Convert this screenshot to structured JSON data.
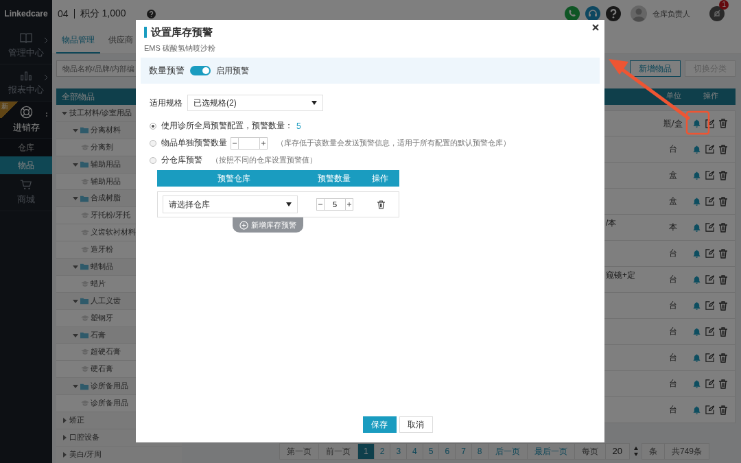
{
  "topbar": {
    "logo": "Linkedcare",
    "store": "04",
    "points": "积分 1,000",
    "user": "仓库负责人",
    "notification_count": "1"
  },
  "sidebar": {
    "items": [
      {
        "label": "管理中心",
        "kind": "module",
        "expanded": false
      },
      {
        "label": "报表中心",
        "kind": "module",
        "expanded": false
      },
      {
        "label": "进销存",
        "kind": "module",
        "expanded": true,
        "badge": "新"
      },
      {
        "label": "仓库",
        "kind": "sub",
        "selected": false
      },
      {
        "label": "物品",
        "kind": "sub",
        "selected": true
      },
      {
        "label": "商城",
        "kind": "module",
        "expanded": false
      }
    ]
  },
  "tabs": [
    {
      "label": "物品管理",
      "selected": true
    },
    {
      "label": "供应商",
      "selected": false
    }
  ],
  "search": {
    "placeholder": "物品名称/品牌/内部编"
  },
  "buttons": [
    {
      "label": "新增物品",
      "disabled": false
    },
    {
      "label": "切换分类",
      "disabled": true
    }
  ],
  "tree": {
    "header": "全部物品",
    "items": [
      {
        "label": "技工材料/诊室用品",
        "kind": "category",
        "expanded": true,
        "children": [
          {
            "label": "分离材料",
            "kind": "folder",
            "expanded": true,
            "children": [
              {
                "label": "分离剂",
                "kind": "item"
              }
            ]
          },
          {
            "label": "辅助用品",
            "kind": "folder",
            "expanded": true,
            "children": [
              {
                "label": "辅助用品",
                "kind": "item"
              }
            ]
          },
          {
            "label": "合成树脂",
            "kind": "folder",
            "expanded": true,
            "children": [
              {
                "label": "牙托粉/牙托",
                "kind": "item"
              },
              {
                "label": "义齿软衬材料",
                "kind": "item"
              },
              {
                "label": "造牙粉",
                "kind": "item"
              }
            ]
          },
          {
            "label": "蜡制品",
            "kind": "folder",
            "expanded": true,
            "children": [
              {
                "label": "蜡片",
                "kind": "item"
              }
            ]
          },
          {
            "label": "人工义齿",
            "kind": "folder",
            "expanded": true,
            "children": [
              {
                "label": "塑钢牙",
                "kind": "item"
              }
            ]
          },
          {
            "label": "石膏",
            "kind": "folder",
            "expanded": true,
            "children": [
              {
                "label": "超硬石膏",
                "kind": "item"
              },
              {
                "label": "硬石膏",
                "kind": "item"
              }
            ]
          },
          {
            "label": "诊所备用品",
            "kind": "folder",
            "expanded": true,
            "children": [
              {
                "label": "诊所备用品",
                "kind": "item"
              }
            ]
          }
        ]
      },
      {
        "label": "矫正",
        "kind": "category",
        "expanded": false
      },
      {
        "label": "口腔设备",
        "kind": "category",
        "expanded": false
      },
      {
        "label": "美白/牙周",
        "kind": "category",
        "expanded": false
      }
    ]
  },
  "table": {
    "columns": [
      "单位",
      "操作"
    ],
    "rows": [
      {
        "unit": "瓶/盒"
      },
      {
        "unit": "台"
      },
      {
        "unit": "盒"
      },
      {
        "unit": "盒"
      },
      {
        "column_1": "/本",
        "unit": "本"
      },
      {
        "unit": "台"
      },
      {
        "column_1": "窥镜+定",
        "unit": "台"
      },
      {
        "unit": "台"
      },
      {
        "unit": "台"
      },
      {
        "unit": "台"
      },
      {
        "unit": "台"
      },
      {
        "unit": "台"
      }
    ]
  },
  "pagination": {
    "first": "第一页",
    "prev": "前一页",
    "pages": [
      {
        "label": "1",
        "selected": true
      },
      {
        "label": "2",
        "selected": false
      },
      {
        "label": "3",
        "selected": false
      },
      {
        "label": "4",
        "selected": false
      },
      {
        "label": "5",
        "selected": false
      },
      {
        "label": "6",
        "selected": false
      },
      {
        "label": "7",
        "selected": false
      },
      {
        "label": "8",
        "selected": false
      }
    ],
    "next": "后一页",
    "last": "最后一页",
    "per_page_label": "每页",
    "per_page": "20",
    "unit": "条",
    "total": "共749条"
  },
  "dialog": {
    "title": "设置库存预警",
    "subtitle": "EMS 碳酸氢钠喷沙粉",
    "section_label": "数量预警",
    "toggle": {
      "on": true,
      "label": "启用预警"
    },
    "spec": {
      "label": "适用规格",
      "value": "已选规格(2)"
    },
    "options": [
      {
        "kind": "global",
        "selected": true,
        "label": "使用诊所全局预警配置，预警数量：",
        "value": "5"
      },
      {
        "kind": "single",
        "selected": false,
        "label": "物品单独预警数量",
        "note": "（库存低于该数量会发送预警信息，适用于所有配置的默认预警仓库）"
      },
      {
        "kind": "warehouse",
        "selected": false,
        "label": "分仓库预警",
        "note": "（按照不同的仓库设置预警值）"
      }
    ],
    "warehouse_table": {
      "columns": [
        "预警仓库",
        "预警数量",
        "操作"
      ],
      "rows": [
        {
          "placeholder": "请选择仓库",
          "quantity": "5"
        }
      ]
    },
    "add_button": "新增库存预警",
    "save": "保存",
    "cancel": "取消"
  }
}
